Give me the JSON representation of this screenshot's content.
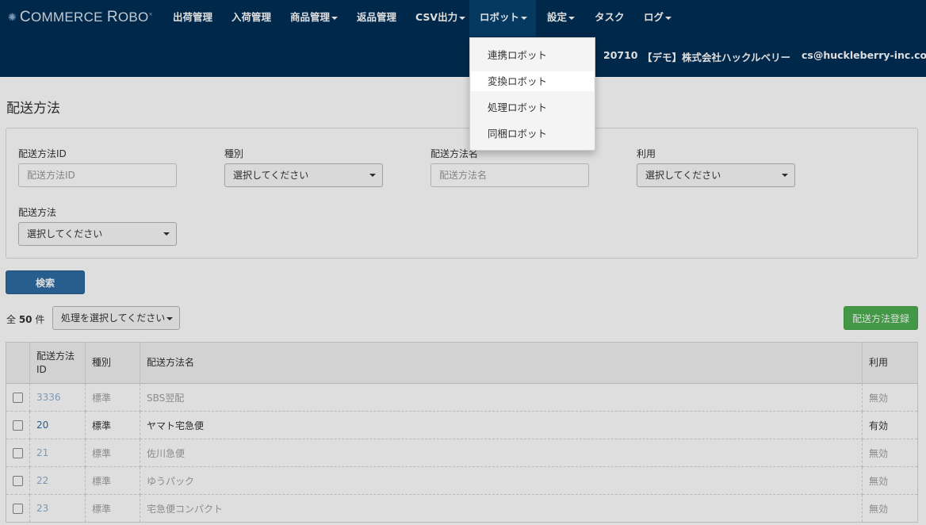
{
  "brand": {
    "logo_text_c": "C",
    "logo_text_1": "OMMERCE ",
    "logo_text_r": "R",
    "logo_text_2": "OBO",
    "logo_star": "×"
  },
  "nav": {
    "items": [
      {
        "label": "出荷管理",
        "caret": false
      },
      {
        "label": "入荷管理",
        "caret": false
      },
      {
        "label": "商品管理",
        "caret": true
      },
      {
        "label": "返品管理",
        "caret": false
      },
      {
        "label": "CSV出力",
        "caret": true
      },
      {
        "label": "ロボット",
        "caret": true,
        "active": true
      },
      {
        "label": "設定",
        "caret": true
      },
      {
        "label": "タスク",
        "caret": false
      },
      {
        "label": "ログ",
        "caret": true
      }
    ],
    "store_id": "20710",
    "company": "【デモ】株式会社ハックルベリー",
    "user_email": "cs@huckleberry-inc.com"
  },
  "robot_menu": {
    "items": [
      "連携ロボット",
      "変換ロボット",
      "処理ロボット",
      "同梱ロボット"
    ],
    "hovered": "変換ロボット"
  },
  "page": {
    "title": "配送方法"
  },
  "search": {
    "fields": {
      "id": {
        "label": "配送方法ID",
        "placeholder": "配送方法ID"
      },
      "type": {
        "label": "種別",
        "value": "選択してください"
      },
      "name": {
        "label": "配送方法名",
        "placeholder": "配送方法名"
      },
      "usage": {
        "label": "利用",
        "value": "選択してください"
      },
      "method": {
        "label": "配送方法",
        "value": "選択してください"
      }
    },
    "search_button": "検索"
  },
  "list": {
    "count_prefix": "全 ",
    "count": "50",
    "count_suffix": " 件",
    "bulk_action": "処理を選択してください",
    "register_button": "配送方法登録",
    "columns": {
      "id_line1": "配送方法",
      "id_line2": "ID",
      "type": "種別",
      "name": "配送方法名",
      "usage": "利用"
    },
    "rows": [
      {
        "id": "3336",
        "type": "標準",
        "name": "SBS翌配",
        "usage": "無効"
      },
      {
        "id": "20",
        "type": "標準",
        "name": "ヤマト宅急便",
        "usage": "有効"
      },
      {
        "id": "21",
        "type": "標準",
        "name": "佐川急便",
        "usage": "無効"
      },
      {
        "id": "22",
        "type": "標準",
        "name": "ゆうパック",
        "usage": "無効"
      },
      {
        "id": "23",
        "type": "標準",
        "name": "宅急便コンパクト",
        "usage": "無効"
      }
    ]
  },
  "colors": {
    "header_bg": "#002e57",
    "active_nav": "#06426f",
    "search_btn": "#2e6da4",
    "register_btn": "#4caf50"
  }
}
